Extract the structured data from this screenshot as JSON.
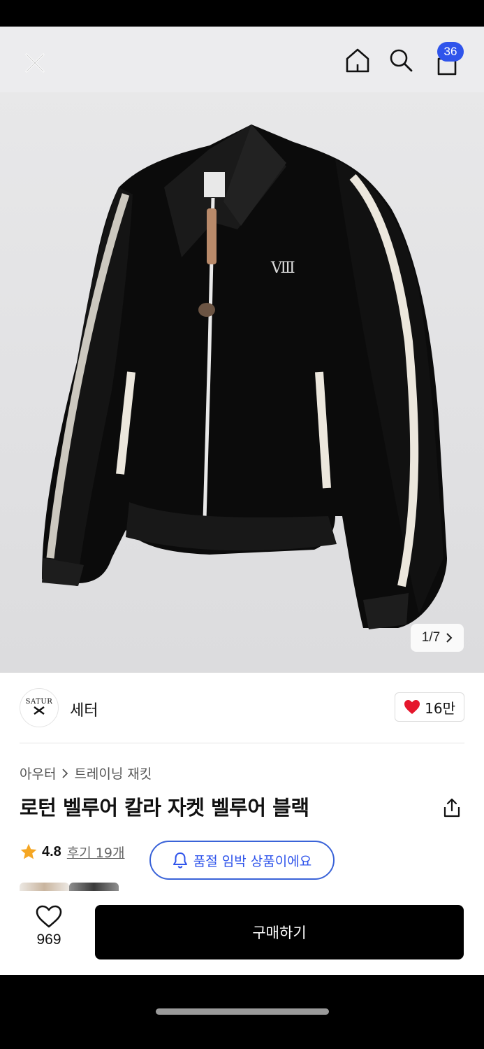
{
  "header": {
    "cart_count": "36"
  },
  "gallery": {
    "counter": "1/7"
  },
  "brand": {
    "name": "세터",
    "logo_text": "SATUR",
    "likes": "16만"
  },
  "product": {
    "breadcrumb": [
      "아우터",
      "트레이닝 재킷"
    ],
    "title": "로턴 벨루어 칼라 자켓 벨루어 블랙",
    "rating": "4.8",
    "reviews": "후기 19개",
    "stock_notice": "품절 임박 상품이에요"
  },
  "actions": {
    "wish_count": "969",
    "buy_label": "구매하기"
  },
  "colors": {
    "accent_blue": "#2f54eb",
    "heart_red": "#e5162c",
    "star": "#f5a623",
    "buy_bg": "#000000"
  },
  "icons": [
    "close-icon",
    "home-icon",
    "search-icon",
    "bag-icon",
    "chevron-right-icon",
    "heart-icon",
    "share-icon",
    "bell-icon",
    "star-icon"
  ]
}
